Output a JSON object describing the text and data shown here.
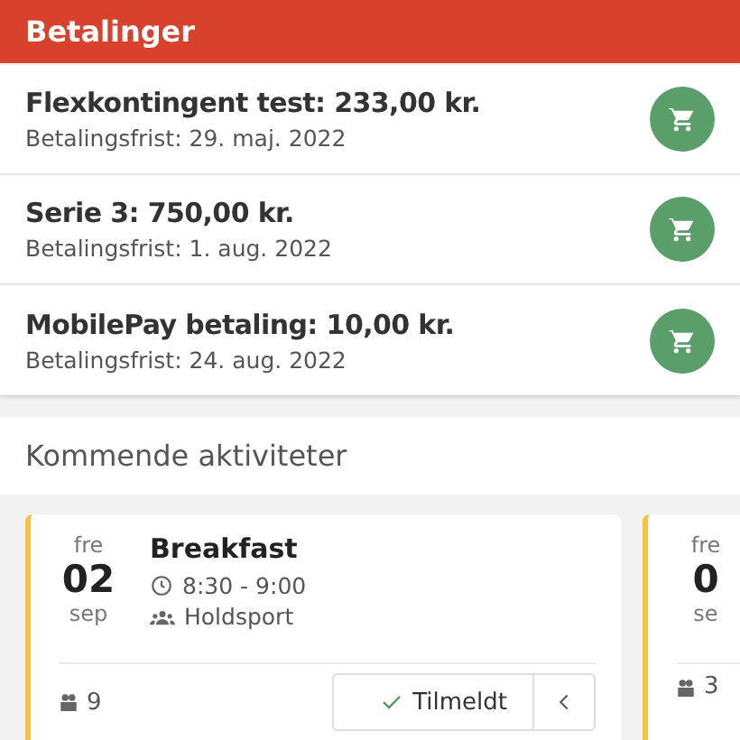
{
  "header": {
    "title": "Betalinger"
  },
  "payments": [
    {
      "title": "Flexkontingent test: 233,00 kr.",
      "due": "Betalingsfrist: 29. maj. 2022"
    },
    {
      "title": "Serie 3: 750,00 kr.",
      "due": "Betalingsfrist: 1. aug. 2022"
    },
    {
      "title": "MobilePay betaling: 10,00 kr.",
      "due": "Betalingsfrist: 24. aug. 2022"
    }
  ],
  "activities": {
    "heading": "Kommende aktiviteter",
    "cards": [
      {
        "weekday": "fre",
        "day": "02",
        "month": "sep",
        "title": "Breakfast",
        "time": "8:30 - 9:00",
        "team": "Holdsport",
        "count": "9",
        "status": "Tilmeldt",
        "color": "#f2c53d"
      },
      {
        "weekday": "fre",
        "day": "0",
        "month": "se",
        "count": "3",
        "color": "#f2c53d"
      }
    ]
  }
}
